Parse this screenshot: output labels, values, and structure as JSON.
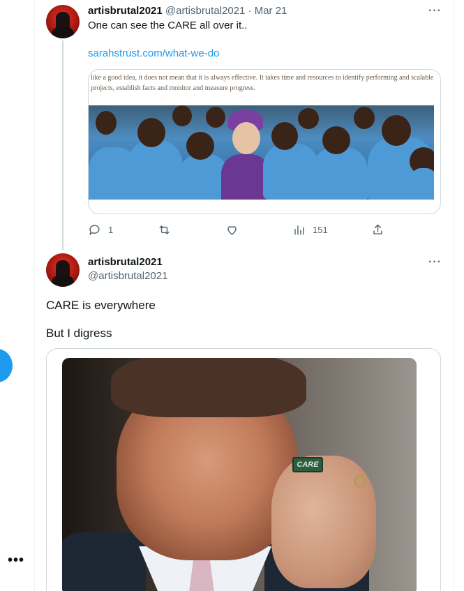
{
  "left_rail": {
    "more_icon": "more-horizontal-icon",
    "fab_color": "#1d9bf0"
  },
  "tweet1": {
    "display_name": "artisbrutal2021",
    "handle": "@artisbrutal2021",
    "separator": "·",
    "date": "Mar 21",
    "text": "One can see the CARE all over it..",
    "link_text": "sarahstrust.com/what-we-do",
    "card": {
      "snippet": "like a good idea, it does not mean that it is always effective. It takes time and resources to identify performing and scalable projects, establish facts and monitor and measure progress."
    },
    "actions": {
      "reply_count": "1",
      "retweet_count": "",
      "like_count": "",
      "views_count": "151"
    }
  },
  "tweet2": {
    "display_name": "artisbrutal2021",
    "handle": "@artisbrutal2021",
    "line1": "CARE is everywhere",
    "line2": "But I digress",
    "chip_label": "CARE"
  },
  "colors": {
    "link": "#1d9bf0",
    "muted": "#536471",
    "border": "#cfd9de"
  }
}
